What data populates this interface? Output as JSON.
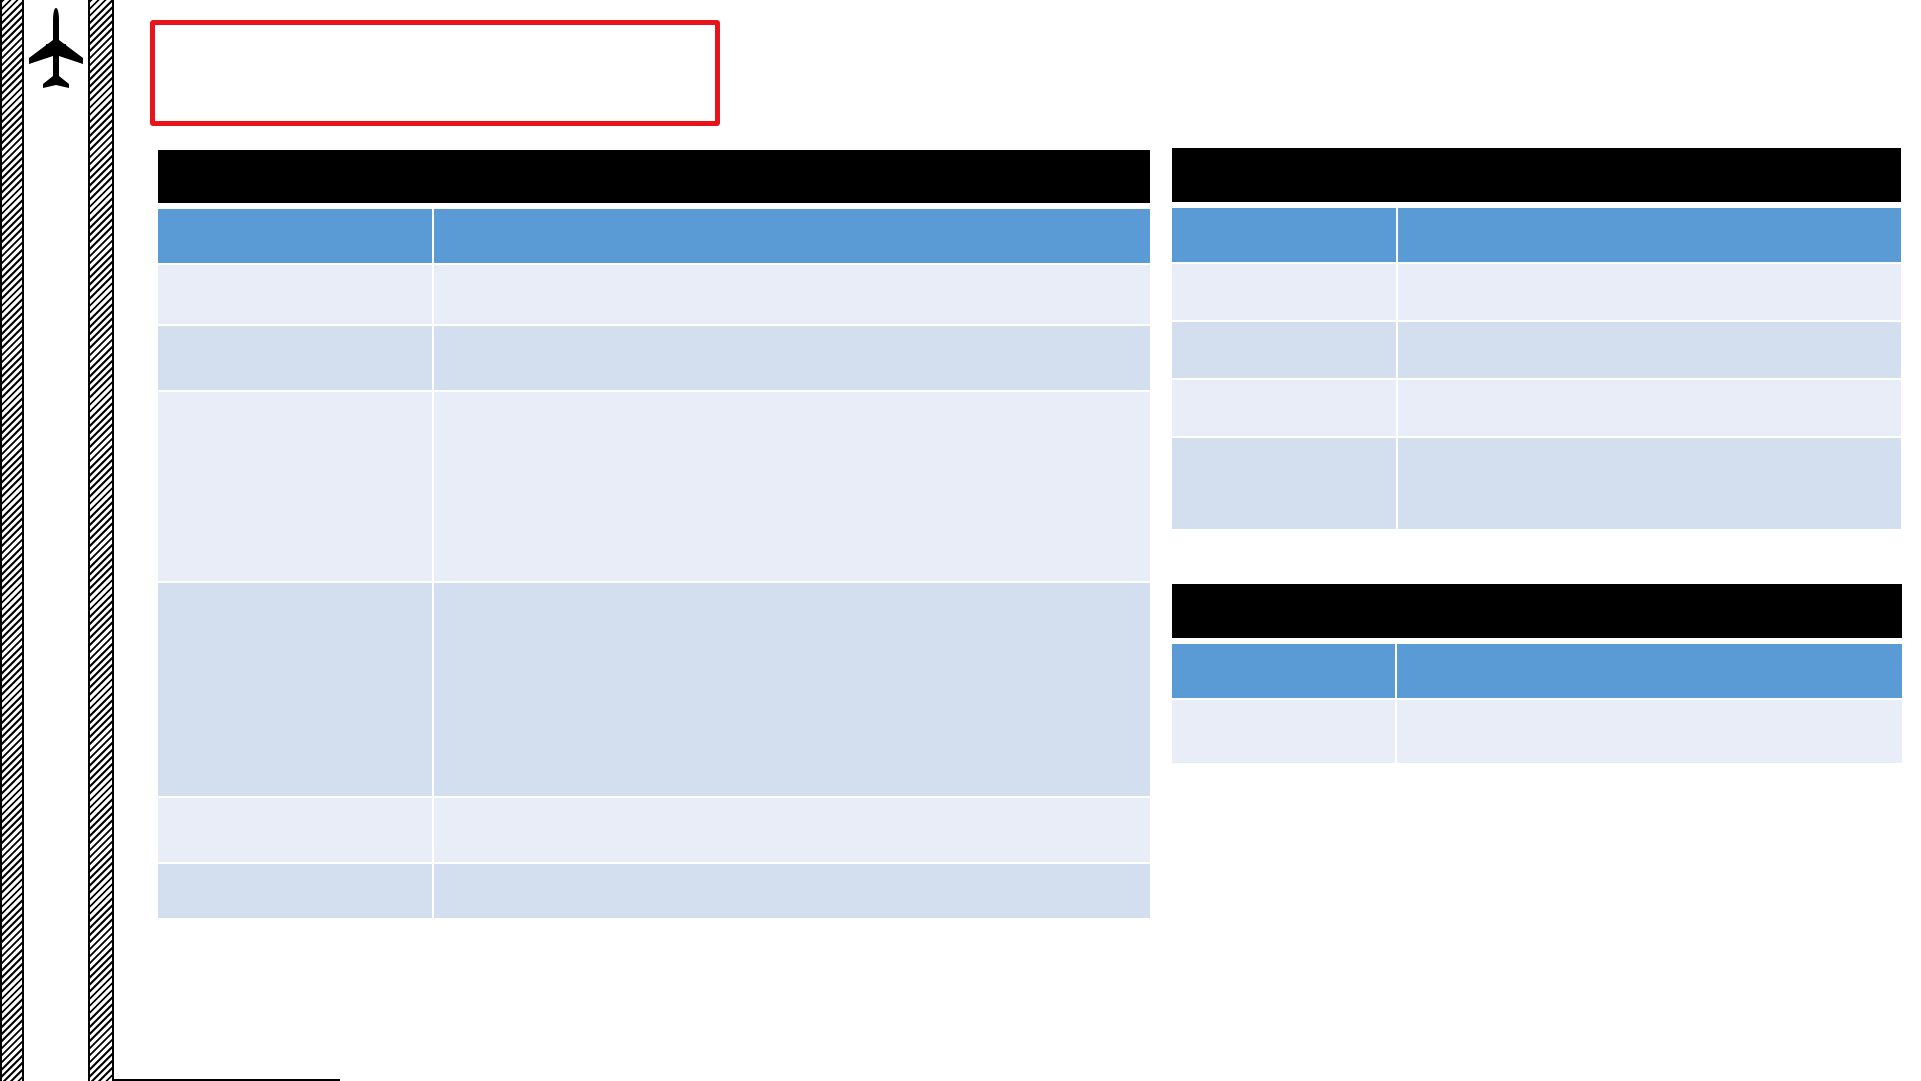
{
  "slide": {
    "title": "",
    "left_table": {
      "title": "",
      "headers": [
        "",
        ""
      ],
      "rows": [
        [
          "",
          ""
        ],
        [
          "",
          ""
        ],
        [
          "",
          ""
        ],
        [
          "",
          ""
        ],
        [
          "",
          ""
        ],
        [
          "",
          ""
        ]
      ]
    },
    "right_top_table": {
      "title": "",
      "headers": [
        "",
        ""
      ],
      "rows": [
        [
          "",
          ""
        ],
        [
          "",
          ""
        ],
        [
          "",
          ""
        ],
        [
          "",
          ""
        ]
      ]
    },
    "right_bottom_table": {
      "title": "",
      "headers": [
        "",
        ""
      ],
      "rows": [
        [
          "",
          ""
        ]
      ]
    }
  },
  "icons": {
    "logo": "airplane-icon"
  },
  "colors": {
    "title_border": "#e8141a",
    "table_title_bg": "#000000",
    "header_bg": "#5b9bd5",
    "row_light": "#e9edf7",
    "row_dark": "#d3dfef"
  }
}
